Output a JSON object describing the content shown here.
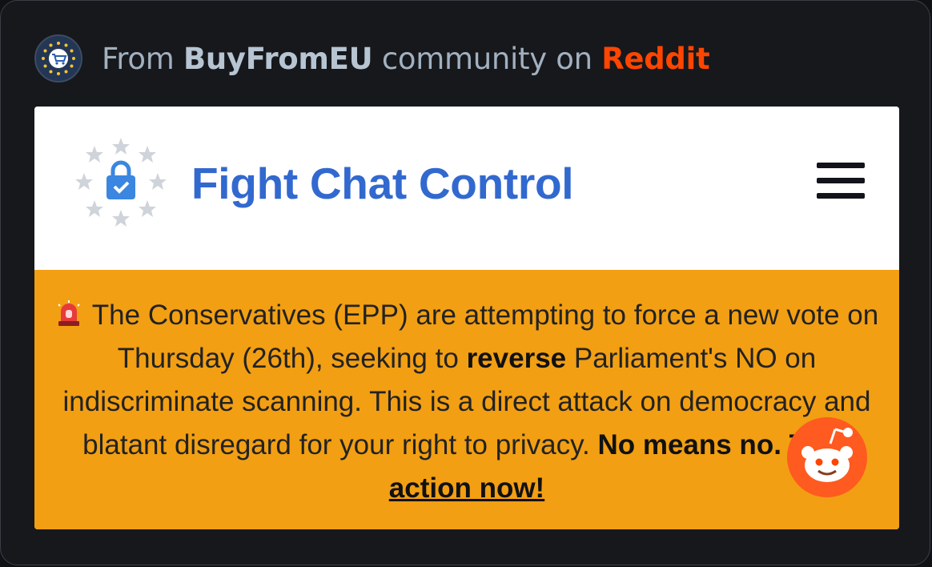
{
  "header": {
    "prefix": "From",
    "community": "BuyFromEU",
    "middle": "community on",
    "platform": "Reddit"
  },
  "site": {
    "title": "Fight Chat Control"
  },
  "banner": {
    "text_1": "The Conservatives (EPP) are attempting to force a new vote on Thursday (26th), seeking to",
    "bold_1": "reverse",
    "text_2": "Parliament's NO on indiscriminate scanning. This is a direct attack on democracy and blatant disregard for your right to privacy.",
    "bold_2": "No means no.",
    "action": "Take action now!"
  },
  "colors": {
    "reddit": "#ff4500",
    "title_blue": "#3269cf",
    "banner_orange": "#f29f13"
  },
  "icons": [
    "community-avatar-icon",
    "lock-stars-logo-icon",
    "hamburger-menu-icon",
    "siren-icon",
    "reddit-snoo-icon"
  ]
}
